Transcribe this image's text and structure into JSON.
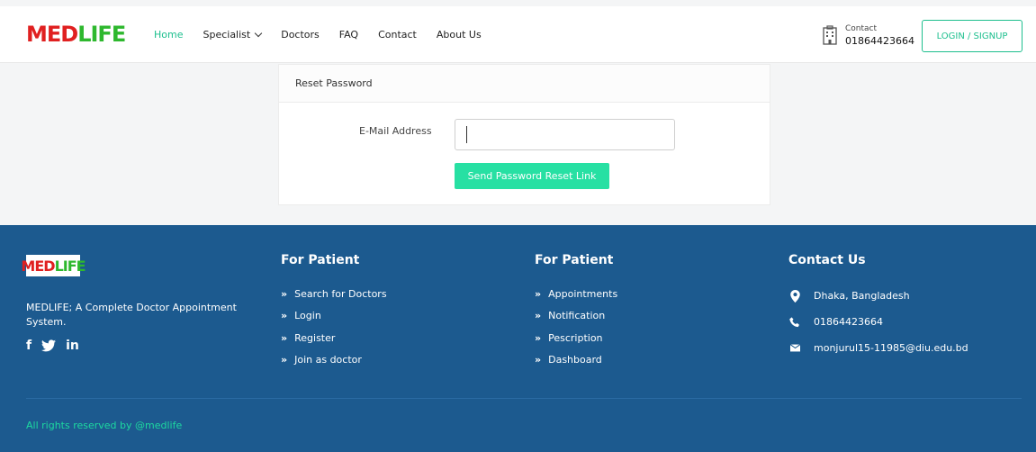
{
  "header": {
    "logo_main": "MED",
    "logo_accent": "LIFE",
    "nav": [
      {
        "label": "Home",
        "active": true
      },
      {
        "label": "Specialist",
        "dropdown": true
      },
      {
        "label": "Doctors"
      },
      {
        "label": "FAQ"
      },
      {
        "label": "Contact"
      },
      {
        "label": "About Us"
      }
    ],
    "contact_label": "Contact",
    "contact_number": "01864423664",
    "login_label": "LOGIN / SIGNUP"
  },
  "card": {
    "title": "Reset Password",
    "email_label": "E-Mail Address",
    "email_value": "",
    "send_label": "Send Password Reset Link"
  },
  "footer": {
    "logo_main": "MED",
    "logo_accent": "LIFE",
    "description": "MEDLIFE; A Complete Doctor Appointment System.",
    "social": [
      "f",
      "🐦",
      "in"
    ],
    "col1": {
      "title": "For Patient",
      "links": [
        "Search for Doctors",
        "Login",
        "Register",
        "Join as doctor"
      ]
    },
    "col2": {
      "title": "For Patient",
      "links": [
        "Appointments",
        "Notification",
        "Pescription",
        "Dashboard"
      ]
    },
    "contact": {
      "title": "Contact Us",
      "address": "Dhaka, Bangladesh",
      "phone": "01864423664",
      "email": "monjurul15-11985@diu.edu.bd"
    },
    "copyright": "All rights reserved by @medlife"
  },
  "colors": {
    "accent": "#1dbf8e",
    "button": "#27e0a3",
    "footer_bg": "#1c5a8f",
    "logo_red": "#e02020",
    "logo_green": "#2eb82e"
  }
}
